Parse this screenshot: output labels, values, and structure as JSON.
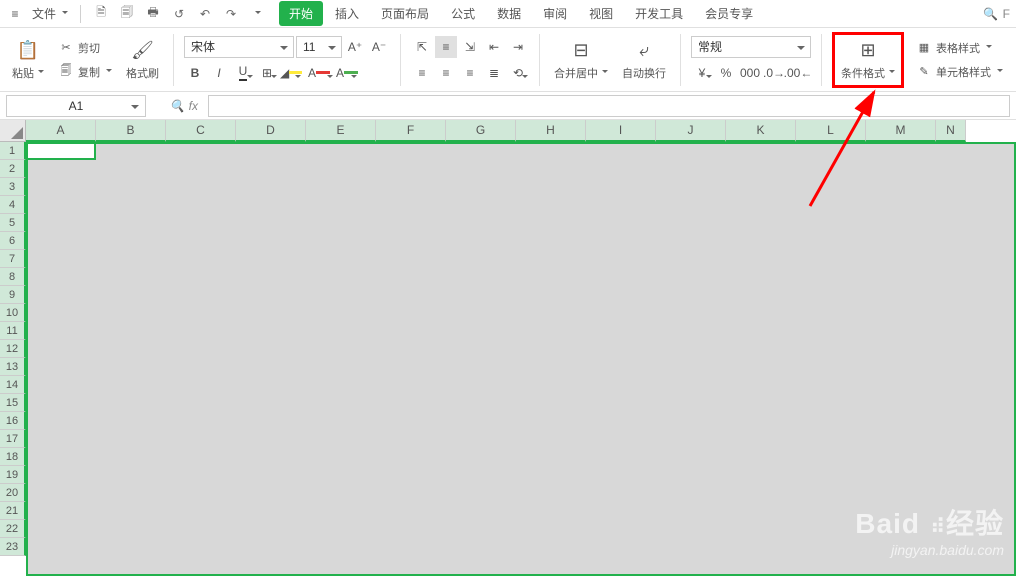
{
  "menu": {
    "file": "文件",
    "tabs": [
      "开始",
      "插入",
      "页面布局",
      "公式",
      "数据",
      "审阅",
      "视图",
      "开发工具",
      "会员专享"
    ],
    "searchGlyph": "F"
  },
  "qa": {
    "save": "⎘",
    "saveAs": "🖫",
    "print": "🖶",
    "preview": "🗋",
    "undo": "↶",
    "redo": "↷"
  },
  "ribbon": {
    "paste": "粘贴",
    "cut": "剪切",
    "copy": "复制",
    "formatPainter": "格式刷",
    "fontName": "宋体",
    "fontSize": "11",
    "mergeCenter": "合并居中",
    "wrapText": "自动换行",
    "numberFormat": "常规",
    "conditionalFormat": "条件格式",
    "tableStyle": "表格样式",
    "cellStyle": "单元格样式"
  },
  "nf": {
    "currency": "¥",
    "percent": "%",
    "comma": "000",
    "decInc": "⁺.00",
    "decDec": ".00⁻"
  },
  "formulaBar": {
    "cellRef": "A1",
    "fx": "fx"
  },
  "columns": [
    "A",
    "B",
    "C",
    "D",
    "E",
    "F",
    "G",
    "H",
    "I",
    "J",
    "K",
    "L",
    "M",
    "N"
  ],
  "rows": [
    1,
    2,
    3,
    4,
    5,
    6,
    7,
    8,
    9,
    10,
    11,
    12,
    13,
    14,
    15,
    16,
    17,
    18,
    19,
    20,
    21,
    22,
    23
  ],
  "watermark": {
    "brand": "Baid",
    "brandSuffix": "经验",
    "url": "jingyan.baidu.com"
  }
}
